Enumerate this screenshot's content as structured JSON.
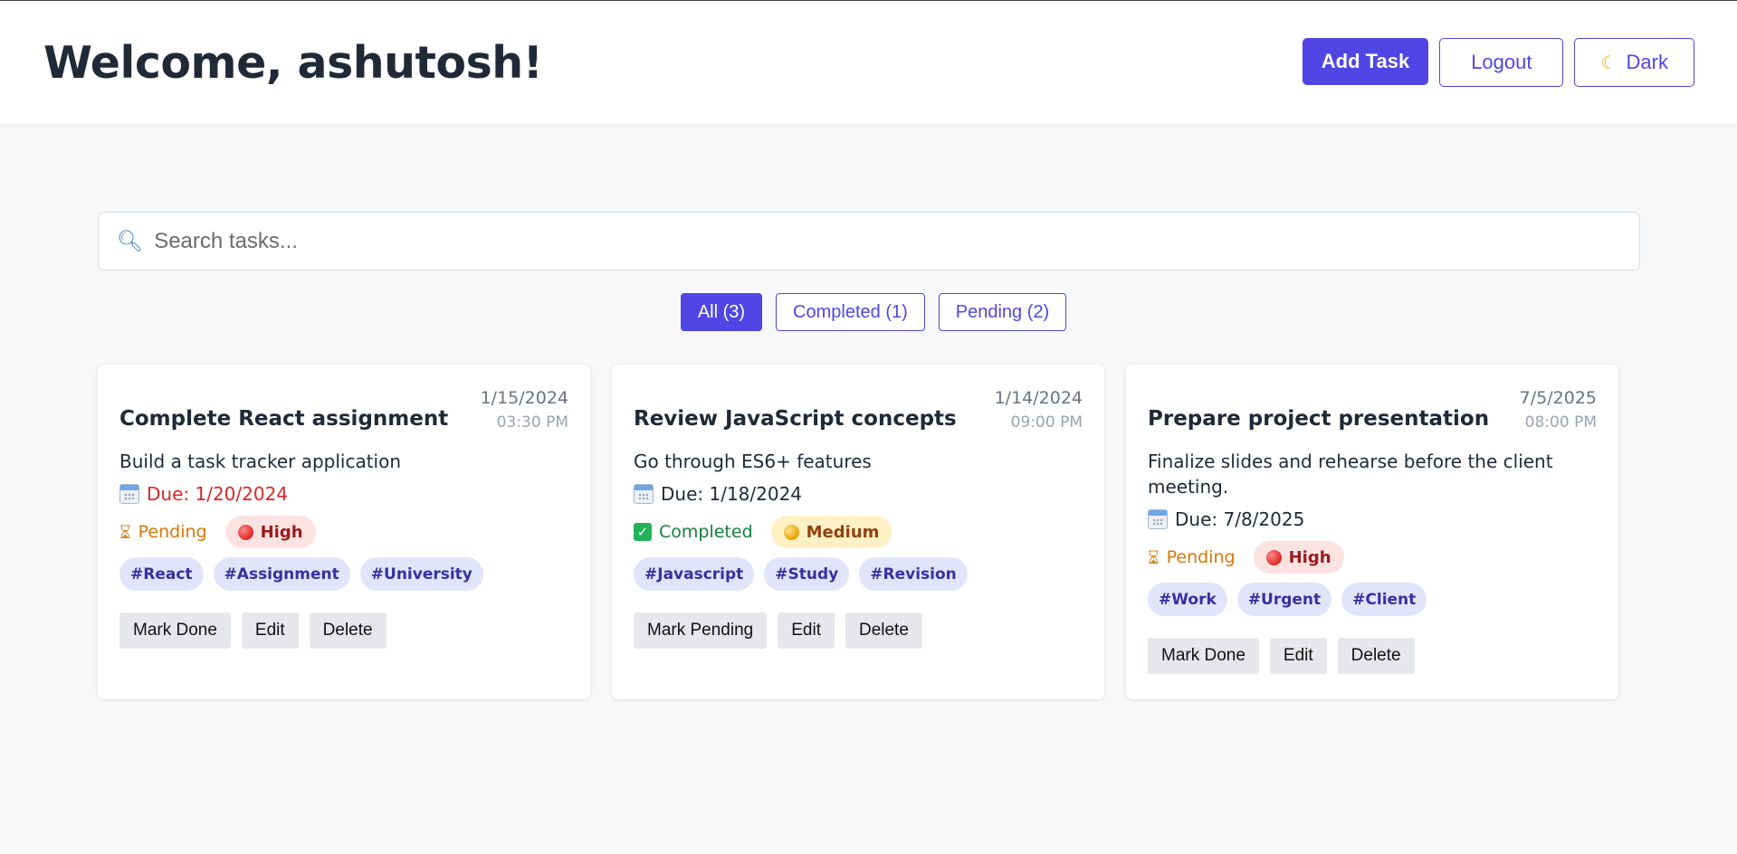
{
  "header": {
    "welcome": "Welcome, ashutosh!",
    "add_task_label": "Add Task",
    "logout_label": "Logout",
    "theme_label": "Dark",
    "theme_icon": "moon-icon"
  },
  "search": {
    "placeholder": "Search tasks...",
    "value": ""
  },
  "filters": [
    {
      "label": "All (3)",
      "active": true
    },
    {
      "label": "Completed (1)",
      "active": false
    },
    {
      "label": "Pending (2)",
      "active": false
    }
  ],
  "tasks": [
    {
      "title": "Complete React assignment",
      "date": "1/15/2024",
      "time": "03:30 PM",
      "description": "Build a task tracker application",
      "due": "Due: 1/20/2024",
      "overdue": true,
      "status": "Pending",
      "priority": "High",
      "tags": [
        "#React",
        "#Assignment",
        "#University"
      ],
      "actions": [
        "Mark Done",
        "Edit",
        "Delete"
      ]
    },
    {
      "title": "Review JavaScript concepts",
      "date": "1/14/2024",
      "time": "09:00 PM",
      "description": "Go through ES6+ features",
      "due": "Due: 1/18/2024",
      "overdue": false,
      "status": "Completed",
      "priority": "Medium",
      "tags": [
        "#Javascript",
        "#Study",
        "#Revision"
      ],
      "actions": [
        "Mark Pending",
        "Edit",
        "Delete"
      ]
    },
    {
      "title": "Prepare project presentation",
      "date": "7/5/2025",
      "time": "08:00 PM",
      "description": "Finalize slides and rehearse before the client meeting.",
      "due": "Due: 7/8/2025",
      "overdue": false,
      "status": "Pending",
      "priority": "High",
      "tags": [
        "#Work",
        "#Urgent",
        "#Client"
      ],
      "actions": [
        "Mark Done",
        "Edit",
        "Delete"
      ]
    }
  ],
  "colors": {
    "accent": "#4f46e5",
    "overdue": "#dc2626",
    "pending": "#d97706",
    "completed": "#15803d"
  }
}
